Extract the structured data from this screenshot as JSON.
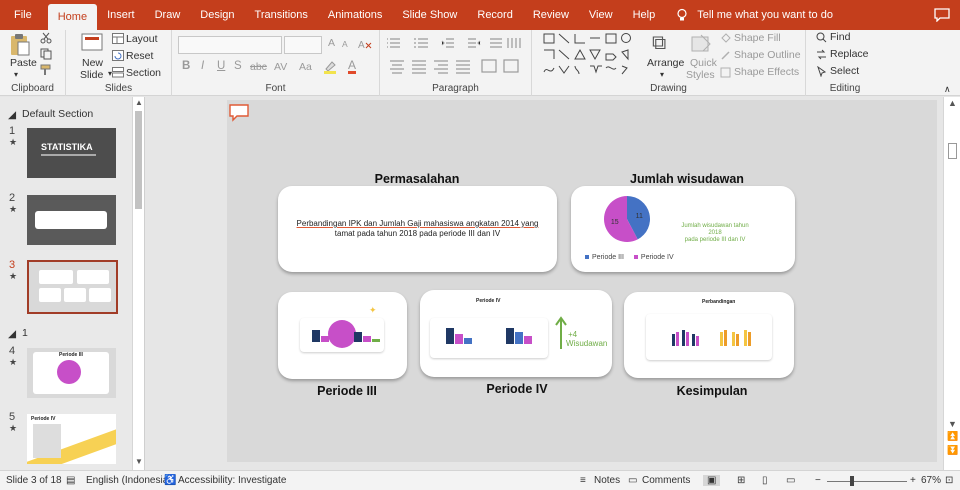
{
  "tabs": [
    "File",
    "Home",
    "Insert",
    "Draw",
    "Design",
    "Transitions",
    "Animations",
    "Slide Show",
    "Record",
    "Review",
    "View",
    "Help"
  ],
  "active_tab": "Home",
  "tell_me": "Tell me what you want to do",
  "ribbon": {
    "clipboard": {
      "paste": "Paste",
      "label": "Clipboard"
    },
    "slides": {
      "new_slide_1": "New",
      "new_slide_2": "Slide",
      "layout": "Layout",
      "reset": "Reset",
      "section": "Section",
      "label": "Slides"
    },
    "font": {
      "bold": "B",
      "italic": "I",
      "underline": "U",
      "shadow": "S",
      "strike": "abc",
      "spacing": "AV",
      "case": "Aa",
      "color": "A",
      "grow": "A",
      "shrink": "A",
      "label": "Font"
    },
    "paragraph": {
      "label": "Paragraph"
    },
    "drawing": {
      "arrange": "Arrange",
      "quick_styles_1": "Quick",
      "quick_styles_2": "Styles",
      "shape_fill": "Shape Fill",
      "shape_outline": "Shape Outline",
      "shape_effects": "Shape Effects",
      "label": "Drawing"
    },
    "editing": {
      "find": "Find",
      "replace": "Replace",
      "select": "Select",
      "label": "Editing"
    }
  },
  "slides_panel": {
    "section_default": "Default Section",
    "section_1": "1",
    "thumbs": [
      {
        "num": "1",
        "title": "STATISTIKA"
      },
      {
        "num": "2"
      },
      {
        "num": "3"
      },
      {
        "num": "4",
        "title": "Periode III"
      },
      {
        "num": "5",
        "title": "Periode IV"
      }
    ]
  },
  "slide": {
    "permasalahan_title": "Permasalahan",
    "permasalahan_text_1": "Perbandingan IPK dan Jumlah Gaji mahasiswa angkatan 2014 yang",
    "permasalahan_text_2": "tamat pada tahun 2018 pada periode III dan IV",
    "wisudawan_title": "Jumlah wisudawan",
    "pie_caption_1": "Jumlah wisudawan tahun 2018",
    "pie_caption_2": "pada periode III dan IV",
    "periode3_title": "Periode III",
    "periode4_title": "Periode IV",
    "periode4_inner_title": "Periode IV",
    "plus_text": "+4",
    "plus_label": "Wisudawan",
    "kesimpulan_title": "Kesimpulan",
    "perbandingan_inner_title": "Perbandingan"
  },
  "chart_data": {
    "type": "pie",
    "categories": [
      "Periode III",
      "Periode IV"
    ],
    "values": [
      11,
      15
    ],
    "colors": [
      "#4472c4",
      "#c74fc8"
    ]
  },
  "status": {
    "slide_of": "Slide 3 of 18",
    "language": "English (Indonesia)",
    "accessibility": "Accessibility: Investigate",
    "notes": "Notes",
    "comments": "Comments",
    "zoom": "67%"
  },
  "colors": {
    "accent": "#c43e1c",
    "pie_blue": "#4472c4",
    "pie_pink": "#c74fc8",
    "green": "#70ad47",
    "navy": "#1f3864"
  }
}
